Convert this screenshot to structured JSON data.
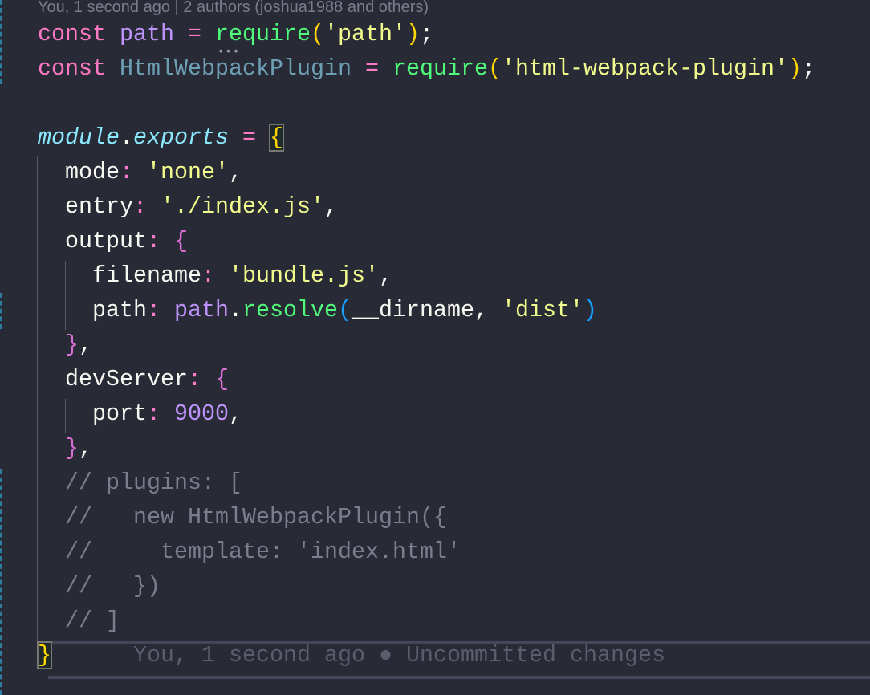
{
  "codelens": "You, 1 second ago | 2 authors (joshua1988 and others)",
  "blame": "You, 1 second ago ● Uncommitted changes",
  "lines": [
    [
      [
        "kw",
        "const "
      ],
      [
        "var",
        "path"
      ],
      [
        "op",
        " = "
      ],
      [
        "fn",
        "require"
      ],
      [
        "p1",
        "("
      ],
      [
        "str",
        "'path'"
      ],
      [
        "p1",
        ")"
      ],
      [
        "txt",
        ";"
      ]
    ],
    [
      [
        "kw",
        "const "
      ],
      [
        "unused",
        "HtmlWebpackPlugin"
      ],
      [
        "op",
        " = "
      ],
      [
        "fn",
        "require"
      ],
      [
        "p1",
        "("
      ],
      [
        "str",
        "'html-webpack-plugin'"
      ],
      [
        "p1",
        ")"
      ],
      [
        "txt",
        ";"
      ]
    ],
    [],
    [
      [
        "mod",
        "module"
      ],
      [
        "txt",
        "."
      ],
      [
        "mod",
        "exports"
      ],
      [
        "op",
        " = "
      ],
      [
        "p1 match",
        "{"
      ]
    ],
    [
      [
        "txt",
        "  mode"
      ],
      [
        "op",
        ": "
      ],
      [
        "str",
        "'none'"
      ],
      [
        "txt",
        ","
      ]
    ],
    [
      [
        "txt",
        "  entry"
      ],
      [
        "op",
        ": "
      ],
      [
        "str",
        "'./index.js'"
      ],
      [
        "txt",
        ","
      ]
    ],
    [
      [
        "txt",
        "  output"
      ],
      [
        "op",
        ": "
      ],
      [
        "p2",
        "{"
      ]
    ],
    [
      [
        "txt",
        "    filename"
      ],
      [
        "op",
        ": "
      ],
      [
        "str",
        "'bundle.js'"
      ],
      [
        "txt",
        ","
      ]
    ],
    [
      [
        "txt",
        "    path"
      ],
      [
        "op",
        ": "
      ],
      [
        "var",
        "path"
      ],
      [
        "txt",
        "."
      ],
      [
        "fn",
        "resolve"
      ],
      [
        "p3",
        "("
      ],
      [
        "txt",
        "__dirname, "
      ],
      [
        "str",
        "'dist'"
      ],
      [
        "p3",
        ")"
      ]
    ],
    [
      [
        "p2",
        "  }"
      ],
      [
        "txt",
        ","
      ]
    ],
    [
      [
        "txt",
        "  devServer"
      ],
      [
        "op",
        ": "
      ],
      [
        "p2",
        "{"
      ]
    ],
    [
      [
        "txt",
        "    port"
      ],
      [
        "op",
        ": "
      ],
      [
        "num",
        "9000"
      ],
      [
        "txt",
        ","
      ]
    ],
    [
      [
        "p2",
        "  }"
      ],
      [
        "txt",
        ","
      ]
    ],
    [
      [
        "cm",
        "  // plugins: ["
      ]
    ],
    [
      [
        "cm",
        "  //   new HtmlWebpackPlugin({"
      ]
    ],
    [
      [
        "cm",
        "  //     template: 'index.html'"
      ]
    ],
    [
      [
        "cm",
        "  //   })"
      ]
    ],
    [
      [
        "cm",
        "  // ]"
      ]
    ],
    [
      [
        "p1 match",
        "}"
      ]
    ]
  ]
}
